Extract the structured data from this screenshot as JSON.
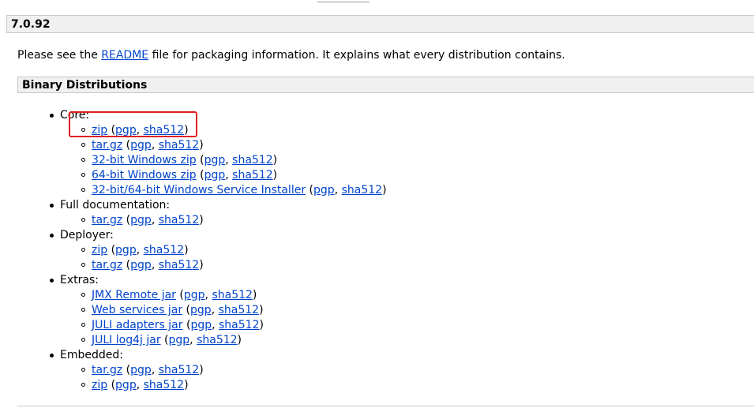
{
  "version": "7.0.92",
  "intro": {
    "before": "Please see the ",
    "link": "README",
    "after": " file for packaging information. It explains what every distribution contains."
  },
  "section_title": "Binary Distributions",
  "groups": [
    {
      "label": "Core:",
      "items": [
        {
          "name": "zip",
          "pgp": "pgp",
          "sha": "sha512"
        },
        {
          "name": "tar.gz",
          "pgp": "pgp",
          "sha": "sha512"
        },
        {
          "name": "32-bit Windows zip",
          "pgp": "pgp",
          "sha": "sha512"
        },
        {
          "name": "64-bit Windows zip",
          "pgp": "pgp",
          "sha": "sha512"
        },
        {
          "name": "32-bit/64-bit Windows Service Installer",
          "pgp": "pgp",
          "sha": "sha512"
        }
      ]
    },
    {
      "label": "Full documentation:",
      "items": [
        {
          "name": "tar.gz",
          "pgp": "pgp",
          "sha": "sha512"
        }
      ]
    },
    {
      "label": "Deployer:",
      "items": [
        {
          "name": "zip",
          "pgp": "pgp",
          "sha": "sha512"
        },
        {
          "name": "tar.gz",
          "pgp": "pgp",
          "sha": "sha512"
        }
      ]
    },
    {
      "label": "Extras:",
      "items": [
        {
          "name": "JMX Remote jar",
          "pgp": "pgp",
          "sha": "sha512"
        },
        {
          "name": "Web services jar",
          "pgp": "pgp",
          "sha": "sha512"
        },
        {
          "name": "JULI adapters jar",
          "pgp": "pgp",
          "sha": "sha512"
        },
        {
          "name": "JULI log4j jar",
          "pgp": "pgp",
          "sha": "sha512"
        }
      ]
    },
    {
      "label": "Embedded:",
      "items": [
        {
          "name": "tar.gz",
          "pgp": "pgp",
          "sha": "sha512"
        },
        {
          "name": "zip",
          "pgp": "pgp",
          "sha": "sha512"
        }
      ]
    }
  ],
  "colors": {
    "link": "#0044cc",
    "highlight": "#e02020",
    "bar_background": "#f0f0f0"
  }
}
